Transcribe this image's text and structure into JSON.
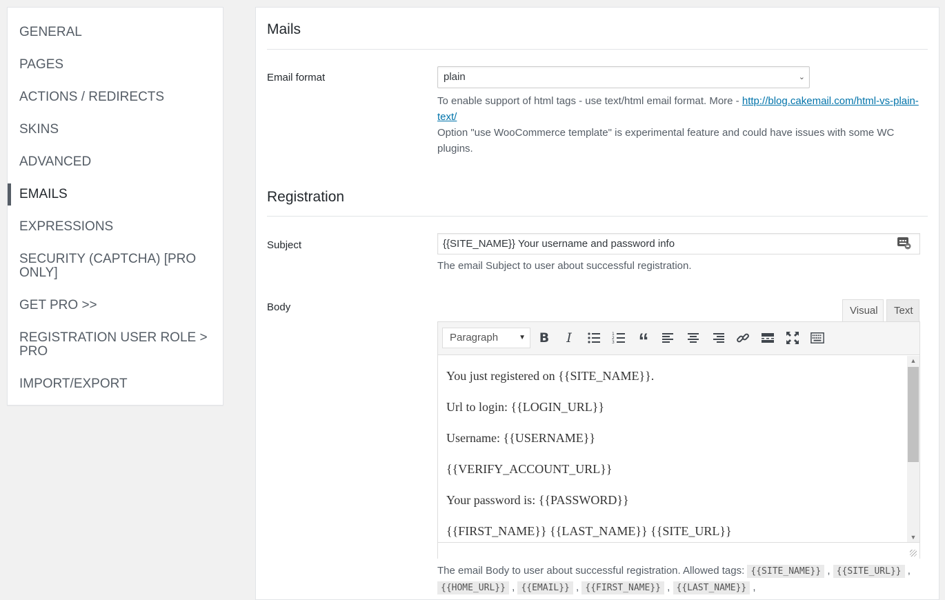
{
  "sidebar": {
    "items": [
      {
        "label": "GENERAL"
      },
      {
        "label": "PAGES"
      },
      {
        "label": "ACTIONS / REDIRECTS"
      },
      {
        "label": "SKINS"
      },
      {
        "label": "ADVANCED"
      },
      {
        "label": "EMAILS",
        "active": true
      },
      {
        "label": "EXPRESSIONS"
      },
      {
        "label": "SECURITY (CAPTCHA) [PRO ONLY]"
      },
      {
        "label": "GET PRO >>"
      },
      {
        "label": "REGISTRATION USER ROLE > PRO"
      },
      {
        "label": "IMPORT/EXPORT"
      }
    ]
  },
  "mails": {
    "title": "Mails",
    "email_format_label": "Email format",
    "email_format_value": "plain",
    "desc_prefix": "To enable support of html tags - use text/html email format. More - ",
    "desc_link": "http://blog.cakemail.com/html-vs-plain-text/",
    "desc_note": "Option \"use WooCommerce template\" is experimental feature and could have issues with some WC plugins."
  },
  "registration": {
    "title": "Registration",
    "subject_label": "Subject",
    "subject_value": "{{SITE_NAME}} Your username and password info",
    "subject_desc": "The email Subject to user about successful registration.",
    "body_label": "Body",
    "tabs": {
      "visual": "Visual",
      "text": "Text"
    },
    "format_select": "Paragraph",
    "body_lines": [
      "You just registered on {{SITE_NAME}}.",
      "Url to login: {{LOGIN_URL}}",
      "Username: {{USERNAME}}",
      "{{VERIFY_ACCOUNT_URL}}",
      "Your password is: {{PASSWORD}}",
      "{{FIRST_NAME}} {{LAST_NAME}} {{SITE_URL}}"
    ],
    "body_desc": "The email Body to user about successful registration. Allowed tags:",
    "allowed_tags": [
      "{{SITE_NAME}}",
      "{{SITE_URL}}",
      "{{HOME_URL}}",
      "{{EMAIL}}",
      "{{FIRST_NAME}}",
      "{{LAST_NAME}}"
    ]
  },
  "colors": {
    "link": "#0073aa",
    "active_indicator": "#555d66"
  }
}
